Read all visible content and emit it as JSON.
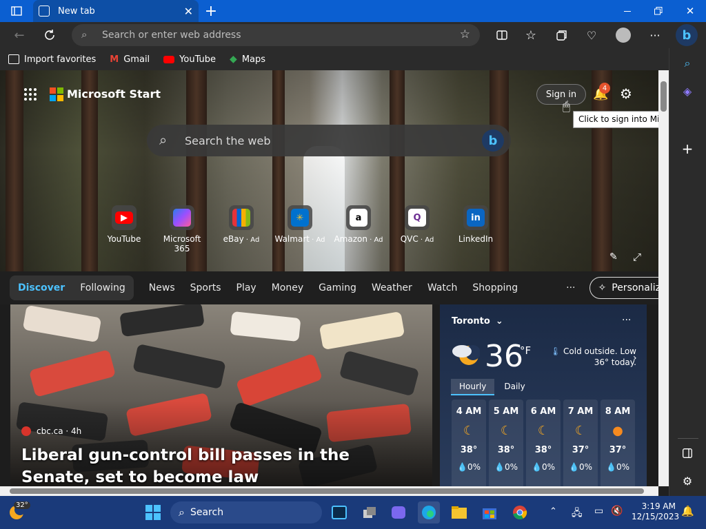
{
  "tab": {
    "title": "New tab"
  },
  "address": {
    "placeholder": "Search or enter web address"
  },
  "favorites": [
    {
      "label": "Import favorites"
    },
    {
      "label": "Gmail"
    },
    {
      "label": "YouTube"
    },
    {
      "label": "Maps"
    }
  ],
  "header": {
    "brand": "Microsoft Start",
    "sign_in": "Sign in",
    "tooltip": "Click to sign into Microsoft Edge",
    "notif_count": "4"
  },
  "hero_search": {
    "placeholder": "Search the web"
  },
  "tiles": [
    {
      "label": "YouTube",
      "ad": ""
    },
    {
      "label": "Microsoft 365",
      "ad": ""
    },
    {
      "label": "eBay",
      "ad": "Ad"
    },
    {
      "label": "Walmart",
      "ad": "Ad"
    },
    {
      "label": "Amazon",
      "ad": "Ad"
    },
    {
      "label": "QVC",
      "ad": "Ad"
    },
    {
      "label": "LinkedIn",
      "ad": ""
    }
  ],
  "nav": {
    "discover": "Discover",
    "following": "Following",
    "items": [
      "News",
      "Sports",
      "Play",
      "Money",
      "Gaming",
      "Weather",
      "Watch",
      "Shopping"
    ],
    "more": "···",
    "personalize": "Personalize"
  },
  "article": {
    "source": "cbc.ca · 4h",
    "headline": "Liberal gun-control bill passes in the Senate, set to become law"
  },
  "weather": {
    "city": "Toronto",
    "temp": "36",
    "unit": "°F",
    "note": "Cold outside. Low 36° today.",
    "tab_hourly": "Hourly",
    "tab_daily": "Daily",
    "hours": [
      {
        "time": "4 AM",
        "temp": "38°",
        "precip": "0%"
      },
      {
        "time": "5 AM",
        "temp": "38°",
        "precip": "0%"
      },
      {
        "time": "6 AM",
        "temp": "38°",
        "precip": "0%"
      },
      {
        "time": "7 AM",
        "temp": "37°",
        "precip": "0%"
      },
      {
        "time": "8 AM",
        "temp": "37°",
        "precip": "0%"
      }
    ]
  },
  "taskbar": {
    "weather_temp": "32°",
    "search": "Search",
    "time": "3:19 AM",
    "date": "12/15/2023"
  },
  "colors": {
    "accent": "#0b5fd1",
    "taskbar": "#1a3a7a",
    "discover": "#4cc2ff"
  }
}
